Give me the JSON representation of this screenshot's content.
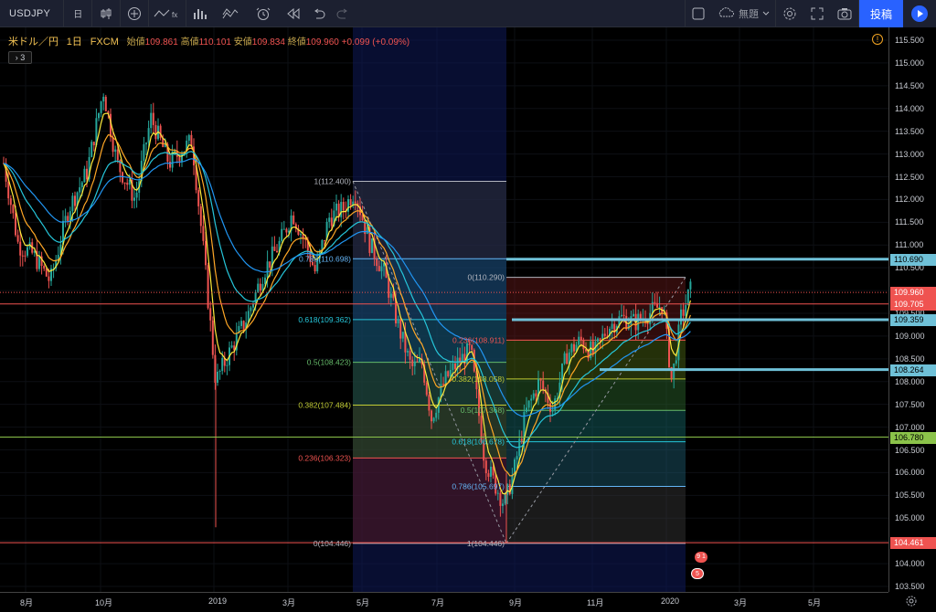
{
  "toolbar": {
    "symbol": "USDJPY",
    "interval": "日",
    "layout_name": "無題",
    "post_label": "投稿",
    "icons": [
      "add-symbol-icon",
      "bar-style-icon",
      "indicators-icon",
      "compare-icon",
      "templates-icon",
      "alert-icon",
      "replay-icon",
      "undo-icon",
      "redo-icon",
      "fullscreen-square-icon",
      "cloud-icon",
      "gear-icon",
      "fullscreen-icon",
      "camera-icon",
      "play-icon"
    ]
  },
  "legend": {
    "title": "米ドル／円",
    "interval": "1日",
    "source": "FXCM",
    "open_label": "始値",
    "open": "109.861",
    "high_label": "高値",
    "high": "110.101",
    "low_label": "安値",
    "low": "109.834",
    "close_label": "終値",
    "close": "109.960",
    "change": "+0.099 (+0.09%)",
    "collapse_label": "3"
  },
  "price_axis": {
    "ticks": [
      "115.500",
      "115.000",
      "114.500",
      "114.000",
      "113.500",
      "113.000",
      "112.500",
      "112.000",
      "111.500",
      "111.000",
      "110.500",
      "110.000",
      "109.500",
      "109.000",
      "108.500",
      "108.000",
      "107.500",
      "107.000",
      "106.500",
      "106.000",
      "105.500",
      "105.000",
      "104.500",
      "104.000",
      "103.500"
    ],
    "tags": [
      {
        "value": "110.690",
        "color": "#6fc1d8",
        "text": "#000"
      },
      {
        "value": "109.960",
        "color": "#ef5350",
        "text": "#fff"
      },
      {
        "value": "109.705",
        "color": "#ef5350",
        "text": "#fff"
      },
      {
        "value": "109.359",
        "color": "#6fc1d8",
        "text": "#000"
      },
      {
        "value": "108.264",
        "color": "#6fc1d8",
        "text": "#000"
      },
      {
        "value": "106.780",
        "color": "#8bc34a",
        "text": "#000"
      },
      {
        "value": "104.461",
        "color": "#ef5350",
        "text": "#fff"
      }
    ]
  },
  "time_axis": [
    "8月",
    "10月",
    "2019",
    "3月",
    "5月",
    "7月",
    "9月",
    "11月",
    "2020",
    "3月",
    "5月"
  ],
  "fib_left": {
    "levels": [
      {
        "label": "1(112.400)",
        "color": "#b2b5be"
      },
      {
        "label": "0.786(110.698)",
        "color": "#64b5f6"
      },
      {
        "label": "0.618(109.362)",
        "color": "#26c6da"
      },
      {
        "label": "0.5(108.423)",
        "color": "#66bb6a"
      },
      {
        "label": "0.382(107.484)",
        "color": "#c0ca33"
      },
      {
        "label": "0.236(106.323)",
        "color": "#ef5350"
      },
      {
        "label": "0(104.446)",
        "color": "#b2b5be"
      }
    ]
  },
  "fib_right": {
    "levels": [
      {
        "label": "0(110.290)",
        "color": "#b2b5be"
      },
      {
        "label": "0.236(108.911)",
        "color": "#ef5350"
      },
      {
        "label": "0.382(108.058)",
        "color": "#c0ca33"
      },
      {
        "label": "0.5(107.368)",
        "color": "#66bb6a"
      },
      {
        "label": "0.618(106.678)",
        "color": "#26c6da"
      },
      {
        "label": "0.786(105.697)",
        "color": "#64b5f6"
      },
      {
        "label": "1(104.446)",
        "color": "#b2b5be"
      }
    ]
  },
  "badges": [
    {
      "label": "9 1"
    },
    {
      "label": "5"
    }
  ],
  "colors": {
    "up": "#26a69a",
    "down": "#ef5350",
    "ema_fast": "#ffeb3b",
    "ema_mid": "#26c6da",
    "ema_slow": "#2196f3",
    "hline": "#6fc1d8"
  }
}
